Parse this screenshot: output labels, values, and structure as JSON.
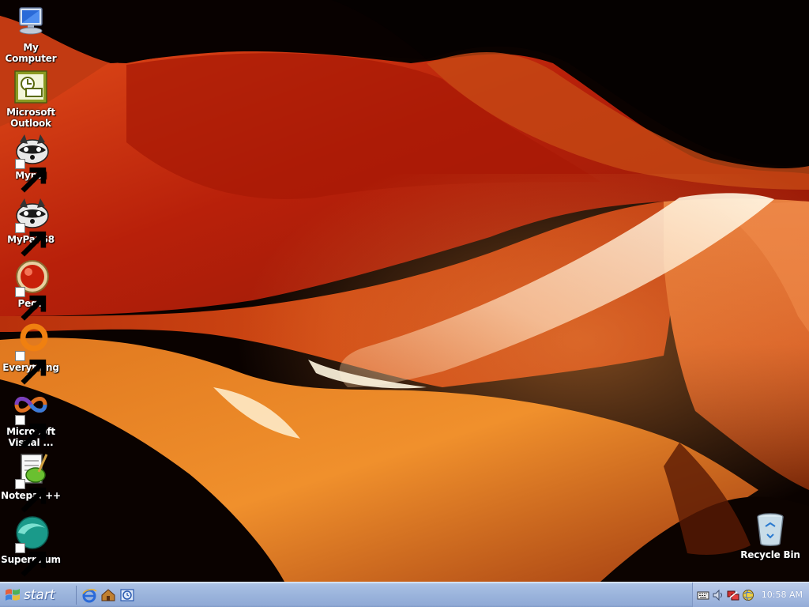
{
  "desktop": {
    "icons": [
      {
        "label": "My Computer",
        "name": "my-computer-icon"
      },
      {
        "label": "Microsoft Outlook",
        "name": "outlook-icon"
      },
      {
        "label": "Mypal",
        "name": "mypal-icon"
      },
      {
        "label": "MyPal 68",
        "name": "mypal68-icon"
      },
      {
        "label": "Pego",
        "name": "pego-icon"
      },
      {
        "label": "Everything",
        "name": "everything-icon"
      },
      {
        "label": "Microsoft Visual ...",
        "name": "visual-studio-icon"
      },
      {
        "label": "Notepad++",
        "name": "notepadpp-icon"
      },
      {
        "label": "Supermium",
        "name": "supermium-icon"
      }
    ],
    "recycle_bin": {
      "label": "Recycle Bin"
    }
  },
  "taskbar": {
    "start_label": "start",
    "quick_launch": [
      "internet-explorer-icon",
      "show-desktop-icon",
      "outlook-express-icon"
    ],
    "tray_icons": [
      "keyboard-icon",
      "volume-icon",
      "network-icon",
      "security-globe-icon"
    ],
    "clock": "10:58 AM"
  },
  "colors": {
    "taskbar": "#9bb4dc",
    "wallpaper_dark": "#0a0200",
    "wallpaper_orange": "#d9561a"
  }
}
